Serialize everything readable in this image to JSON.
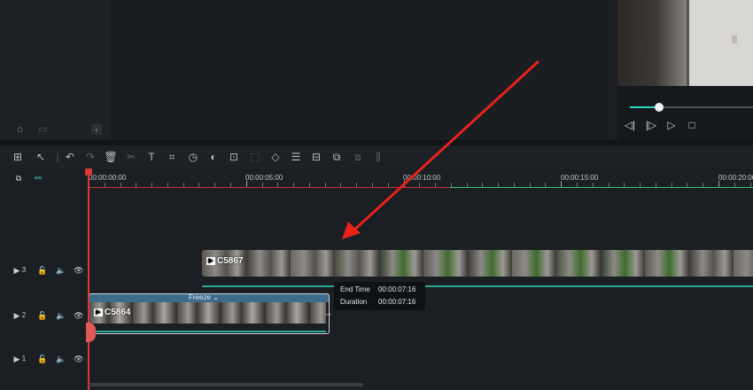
{
  "media_panel": {
    "collapse_glyph": "‹"
  },
  "player": {
    "progress": 0.24,
    "controls": [
      "prev-frame",
      "next-frame",
      "play",
      "stop"
    ]
  },
  "toolbar": {
    "icons": [
      "layout-icon",
      "select-icon",
      "undo-icon",
      "redo-icon",
      "delete-icon",
      "cut-icon",
      "text-icon",
      "crop-icon",
      "speed-icon",
      "color-icon",
      "freeze-frame-icon",
      "ai-icon",
      "mask-icon",
      "adjust-icon",
      "split-audio-icon",
      "voiceover-icon",
      "motion-icon",
      "audio-stretch-icon"
    ]
  },
  "timeline": {
    "ruler_ticks": [
      "00:00:00:00",
      "00:00:05:00",
      "00:00:10:00",
      "00:00:15:00",
      "00:00:20:00"
    ],
    "tracks": [
      {
        "number": "3"
      },
      {
        "number": "2"
      },
      {
        "number": "1"
      }
    ],
    "clips": {
      "upper": {
        "name": "C5867"
      },
      "lower": {
        "name": "C5864",
        "freeze_label": "Freeze ⌄"
      }
    },
    "tooltip": {
      "end_time_label": "End Time",
      "end_time_value": "00:00:07:16",
      "duration_label": "Duration",
      "duration_value": "00:00:07:16"
    }
  },
  "colors": {
    "accent": "#2fd8c3",
    "playhead": "#d83a34",
    "arrow": "#e8211c",
    "freeze_bar": "#3d6b8c"
  }
}
